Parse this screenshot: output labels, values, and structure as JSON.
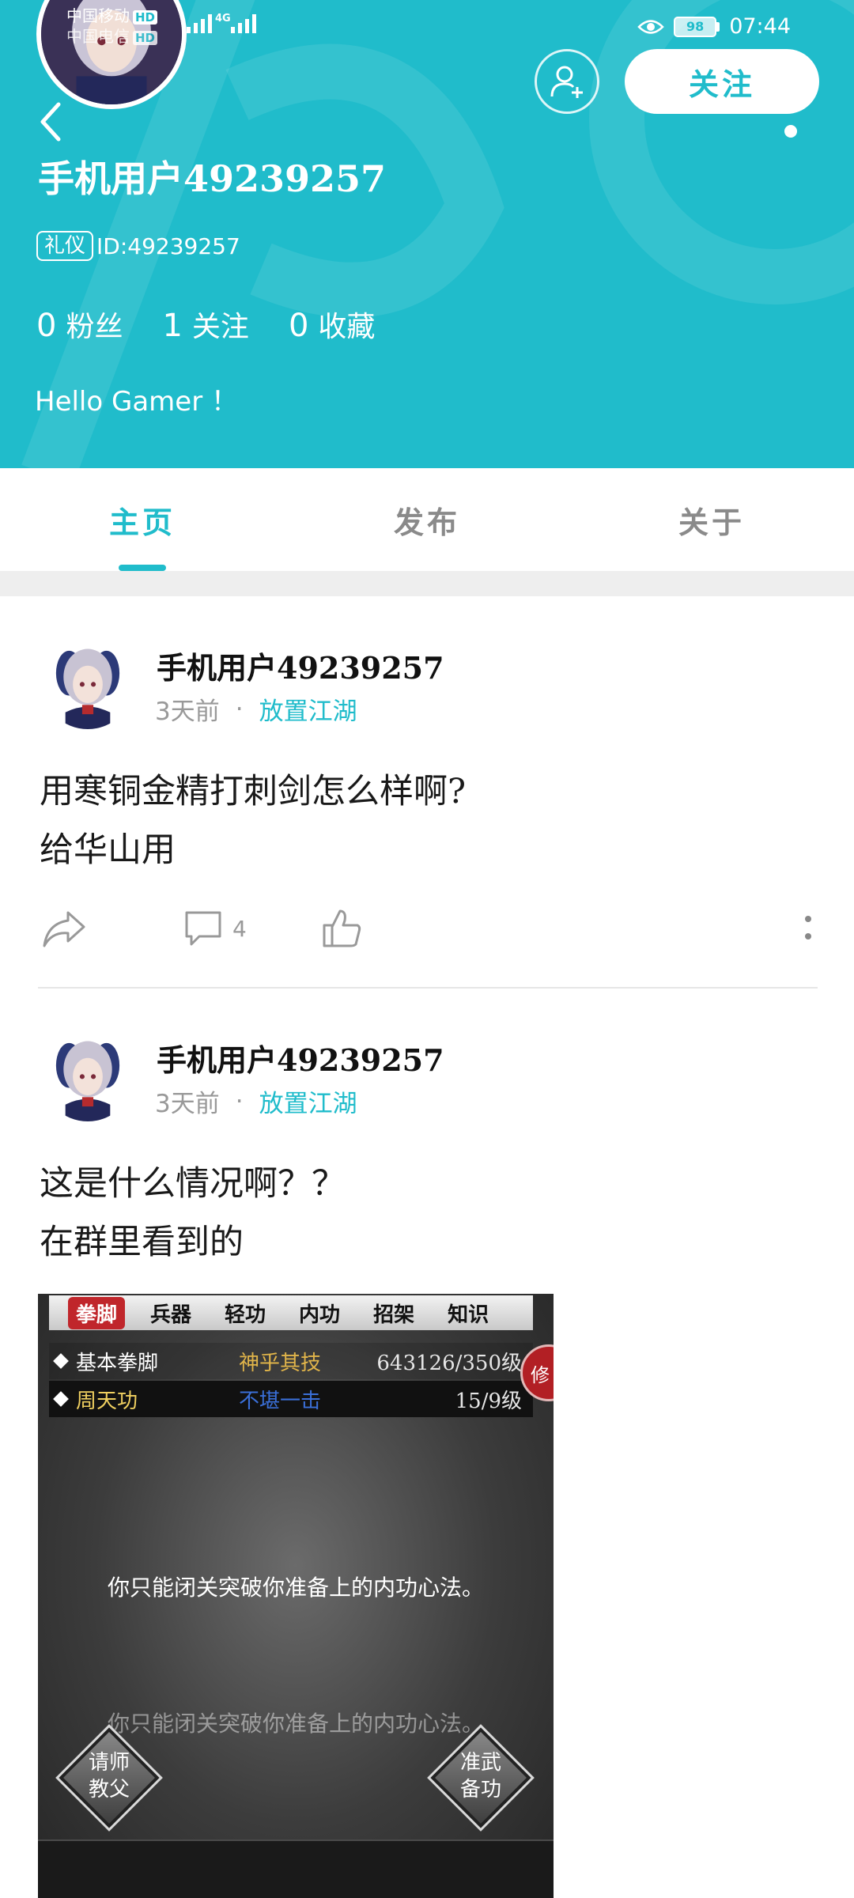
{
  "status_bar": {
    "carrier_line1": "中国移动",
    "carrier_line2": "中国电信",
    "hd": "HD",
    "network": "4G",
    "battery": "98",
    "time": "07:44"
  },
  "profile": {
    "username": "手机用户49239257",
    "role_badge": "礼仪",
    "id_text": "ID:49239257",
    "follow_button": "关注",
    "stats": [
      {
        "value": "0",
        "label": "粉丝"
      },
      {
        "value": "1",
        "label": "关注"
      },
      {
        "value": "0",
        "label": "收藏"
      }
    ],
    "bio": "Hello Gamer ！"
  },
  "tabs": [
    {
      "label": "主页",
      "active": true
    },
    {
      "label": "发布",
      "active": false
    },
    {
      "label": "关于",
      "active": false
    }
  ],
  "posts": [
    {
      "author": "手机用户49239257",
      "time": "3天前",
      "dot": "·",
      "category": "放置江湖",
      "line1": "用寒铜金精打刺剑怎么样啊?",
      "line2": "给华山用",
      "comment_count": "4"
    },
    {
      "author": "手机用户49239257",
      "time": "3天前",
      "dot": "·",
      "category": "放置江湖",
      "line1": "这是什么情况啊？？",
      "line2": "在群里看到的"
    }
  ],
  "game_screenshot": {
    "tabs": [
      "拳脚",
      "兵器",
      "轻功",
      "内功",
      "招架",
      "知识"
    ],
    "rows": [
      {
        "name": "基本拳脚",
        "rank": "神乎其技",
        "level": "643126/350级",
        "rank_color": "#e0b44a"
      },
      {
        "name": "周天功",
        "rank": "不堪一击",
        "level": "15/9级",
        "rank_color": "#3a6fd8"
      }
    ],
    "side_button": "修",
    "message": "你只能闭关突破你准备上的内功心法。",
    "message_faded": "你只能闭关突破你准备上的内功心法。",
    "left_button_line1": "请师",
    "left_button_line2": "教父",
    "right_button_line1": "准武",
    "right_button_line2": "备功"
  },
  "colors": {
    "accent": "#20bccb",
    "text_muted": "#999999"
  }
}
